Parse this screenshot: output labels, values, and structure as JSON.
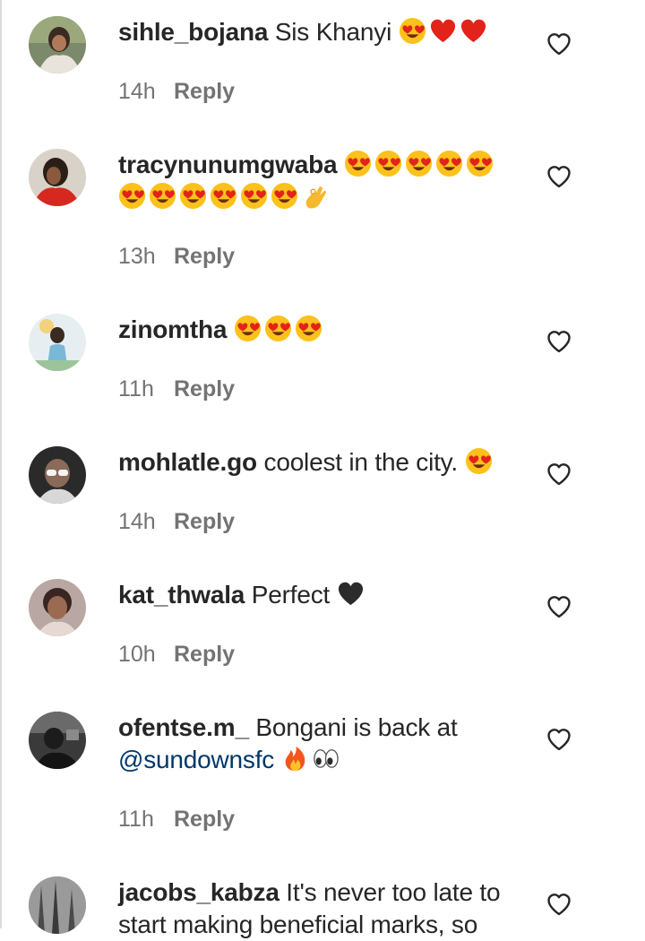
{
  "reply_label": "Reply",
  "colors": {
    "text": "#262626",
    "muted": "#737373",
    "mention": "#00376b"
  },
  "comments": [
    {
      "username": "sihle_bojana",
      "text_before": "Sis Khanyi",
      "mention": "",
      "text_after": "",
      "emojis": [
        "heart-eyes",
        "red-heart",
        "red-heart"
      ],
      "time": "14h"
    },
    {
      "username": "tracynunumgwaba",
      "text_before": "",
      "mention": "",
      "text_after": "",
      "emojis": [
        "heart-eyes",
        "heart-eyes",
        "heart-eyes",
        "heart-eyes",
        "heart-eyes",
        "heart-eyes",
        "heart-eyes",
        "heart-eyes",
        "heart-eyes",
        "heart-eyes",
        "heart-eyes",
        "ok-hand"
      ],
      "time": "13h"
    },
    {
      "username": "zinomtha",
      "text_before": "",
      "mention": "",
      "text_after": "",
      "emojis": [
        "heart-eyes",
        "heart-eyes",
        "heart-eyes"
      ],
      "time": "11h"
    },
    {
      "username": "mohlatle.go",
      "text_before": "coolest in the city.",
      "mention": "",
      "text_after": "",
      "emojis": [
        "heart-eyes"
      ],
      "time": "14h"
    },
    {
      "username": "kat_thwala",
      "text_before": "Perfect",
      "mention": "",
      "text_after": "",
      "emojis": [
        "black-heart"
      ],
      "time": "10h"
    },
    {
      "username": "ofentse.m_",
      "text_before": "Bongani is back at",
      "mention": "@sundownsfc",
      "text_after": "",
      "emojis": [
        "fire",
        "eyes"
      ],
      "time": "11h"
    },
    {
      "username": "jacobs_kabza",
      "text_before": "It's never too late to start making beneficial marks, so",
      "mention": "",
      "text_after": "",
      "emojis": [],
      "time": ""
    }
  ]
}
